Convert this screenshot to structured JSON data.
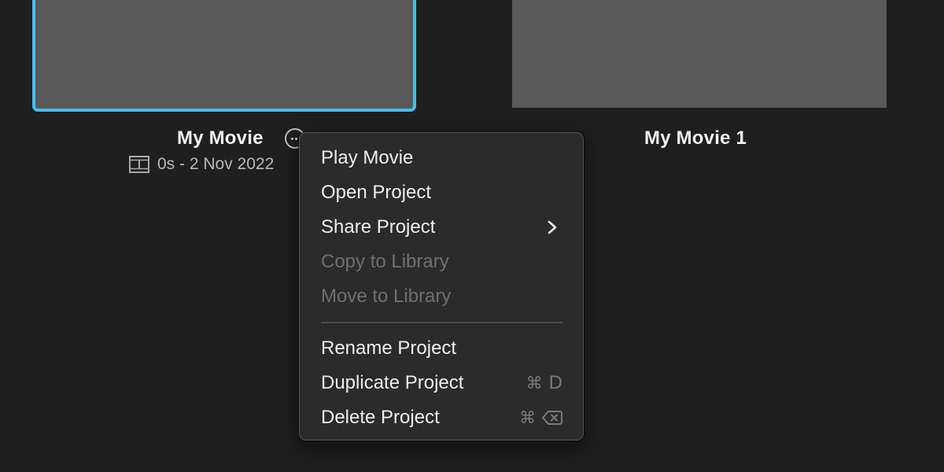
{
  "projects": [
    {
      "title": "My Movie",
      "selected": true,
      "meta": "0s - 2 Nov 2022",
      "thumbnail_color": "#595959",
      "selection_color": "#4bbbec"
    },
    {
      "title": "My Movie 1",
      "selected": false,
      "thumbnail_color": "#595959"
    }
  ],
  "more_button": {
    "icon": "ellipsis-circle-icon"
  },
  "context_menu": {
    "items": [
      {
        "label": "Play Movie",
        "enabled": true
      },
      {
        "label": "Open Project",
        "enabled": true
      },
      {
        "label": "Share Project",
        "enabled": true,
        "submenu": true,
        "submenu_icon": "chevron-right-icon"
      },
      {
        "label": "Copy to Library",
        "enabled": false
      },
      {
        "label": "Move to Library",
        "enabled": false
      },
      {
        "label": "Rename Project",
        "enabled": true
      },
      {
        "label": "Duplicate Project",
        "enabled": true,
        "shortcut": {
          "modifier": "⌘",
          "key": "D"
        }
      },
      {
        "label": "Delete Project",
        "enabled": true,
        "shortcut": {
          "modifier": "⌘",
          "key_icon": "delete-key-icon"
        }
      }
    ]
  },
  "colors": {
    "background": "#1f1f1f",
    "menu_background": "#2b2b2b",
    "text_primary": "#ededed",
    "text_disabled": "#6f6f6f",
    "accent": "#4bbbec"
  }
}
